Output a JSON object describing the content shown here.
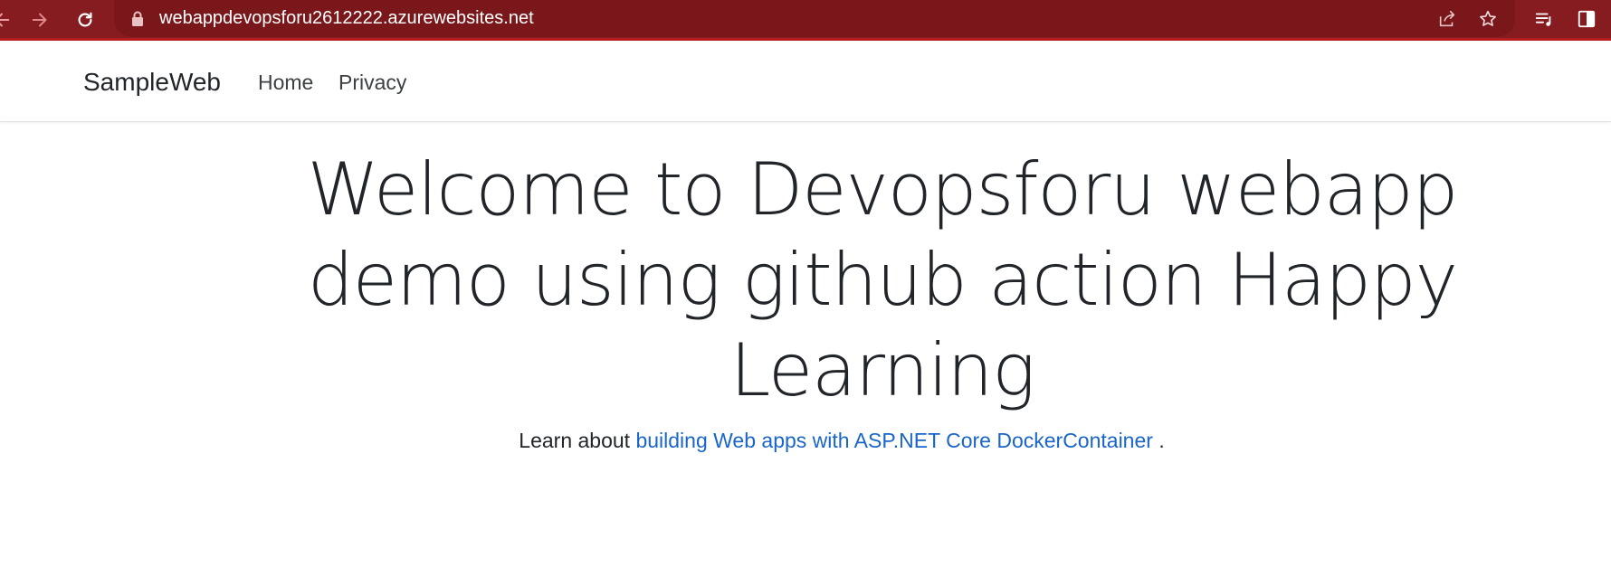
{
  "browser": {
    "url": "webappdevopsforu2612222.azurewebsites.net",
    "icons": [
      "back-icon",
      "forward-icon",
      "reload-icon",
      "lock-icon",
      "share-icon",
      "star-icon",
      "reading-list-icon",
      "side-panel-icon"
    ],
    "colors": {
      "toolbar": "#861b20",
      "omnibox": "#7a171b",
      "accent_line": "#b71c1c"
    }
  },
  "navbar": {
    "brand": "SampleWeb",
    "links": [
      {
        "label": "Home"
      },
      {
        "label": "Privacy"
      }
    ]
  },
  "main": {
    "headline": "Welcome to Devopsforu webapp demo using github action Happy Learning",
    "learn_prefix": "Learn about",
    "learn_link": "building Web apps with ASP.NET Core DockerContainer",
    "learn_suffix": ".",
    "link_color": "#1a65c9"
  }
}
